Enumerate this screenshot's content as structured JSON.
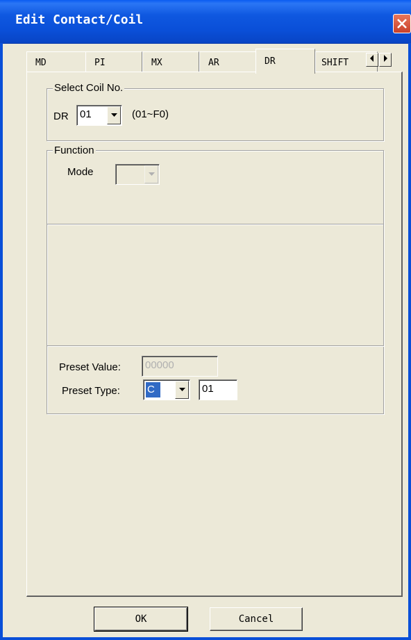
{
  "window": {
    "title": "Edit Contact/Coil"
  },
  "tabs": [
    {
      "label": "MD"
    },
    {
      "label": "PI"
    },
    {
      "label": "MX"
    },
    {
      "label": "AR"
    },
    {
      "label": "DR"
    },
    {
      "label": "SHIFT"
    }
  ],
  "selected_tab": "DR",
  "select_coil": {
    "legend": "Select Coil No.",
    "prefix": "DR",
    "value": "01",
    "range": "(01~F0)"
  },
  "function": {
    "legend": "Function",
    "mode_label": "Mode",
    "mode_value": ""
  },
  "preset": {
    "value_label": "Preset Value:",
    "value": "00000",
    "type_label": "Preset Type:",
    "type_value": "C",
    "type_number": "01"
  },
  "buttons": {
    "ok": "OK",
    "cancel": "Cancel"
  }
}
